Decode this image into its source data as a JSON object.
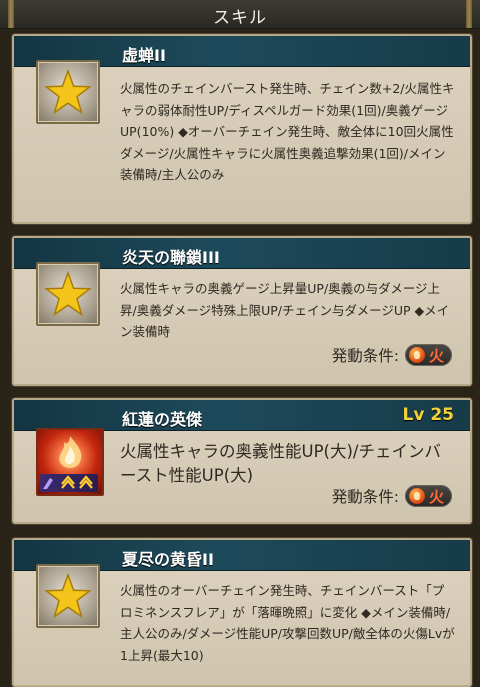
{
  "header": {
    "title": "スキル"
  },
  "skills": [
    {
      "name": "虚蝉II",
      "icon": "star-icon",
      "desc": "火属性のチェインバースト発生時、チェイン数+2/火属性キャラの弱体耐性UP/ディスペルガード効果(1回)/奥義ゲージUP(10%) ◆オーバーチェイン発生時、敵全体に10回火属性ダメージ/火属性キャラに火属性奥義追撃効果(1回)/メイン装備時/主人公のみ"
    },
    {
      "name": "炎天の聯鎖III",
      "icon": "star-icon",
      "desc": "火属性キャラの奥義ゲージ上昇量UP/奥義の与ダメージ上昇/奥義ダメージ特殊上限UP/チェイン与ダメージUP ◆メイン装備時",
      "condition_label": "発動条件:",
      "condition_element": "火"
    },
    {
      "name": "紅蓮の英傑",
      "level": "Lv 25",
      "icon": "fire-skill-icon",
      "desc": "火属性キャラの奥義性能UP(大)/チェインバースト性能UP(大)",
      "condition_label": "発動条件:",
      "condition_element": "火"
    },
    {
      "name": "夏尽の黄昏II",
      "icon": "star-icon",
      "desc": "火属性のオーバーチェイン発生時、チェインバースト「プロミネンスフレア」が「落暉晩照」に変化 ◆メイン装備時/主人公のみ/ダメージ性能UP/攻撃回数UP/敵全体の火傷Lvが1上昇(最大10)"
    }
  ],
  "colors": {
    "accent_bar": "#1d4a5b",
    "level": "#f3d23a",
    "fire": "#ff6a3a"
  }
}
